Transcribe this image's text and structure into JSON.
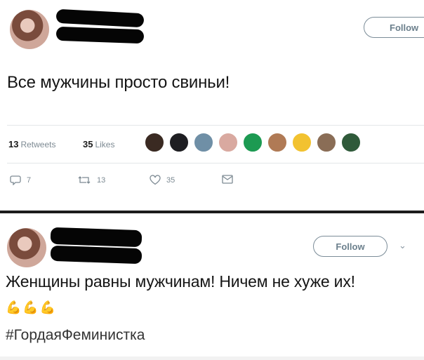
{
  "tweet1": {
    "follow_label": "Follow",
    "text": "Все мужчины просто свиньи!",
    "retweets_count": "13",
    "retweets_label": "Retweets",
    "likes_count": "35",
    "likes_label": "Likes",
    "replies": "7",
    "retweets_action": "13",
    "likes_action": "35",
    "liker_colors": [
      "#3a2a22",
      "#1e1e22",
      "#6f8fa6",
      "#d9a9a0",
      "#1c9a52",
      "#b07a55",
      "#f2c230",
      "#8a6d56",
      "#2f5a3a"
    ]
  },
  "tweet2": {
    "follow_label": "Follow",
    "text": "Женщины равны мужчинам! Ничем не хуже их!",
    "emoji": [
      "muscle-emoji",
      "muscle-emoji",
      "muscle-emoji"
    ],
    "hashtag": "#ГордаяФеминистка"
  }
}
